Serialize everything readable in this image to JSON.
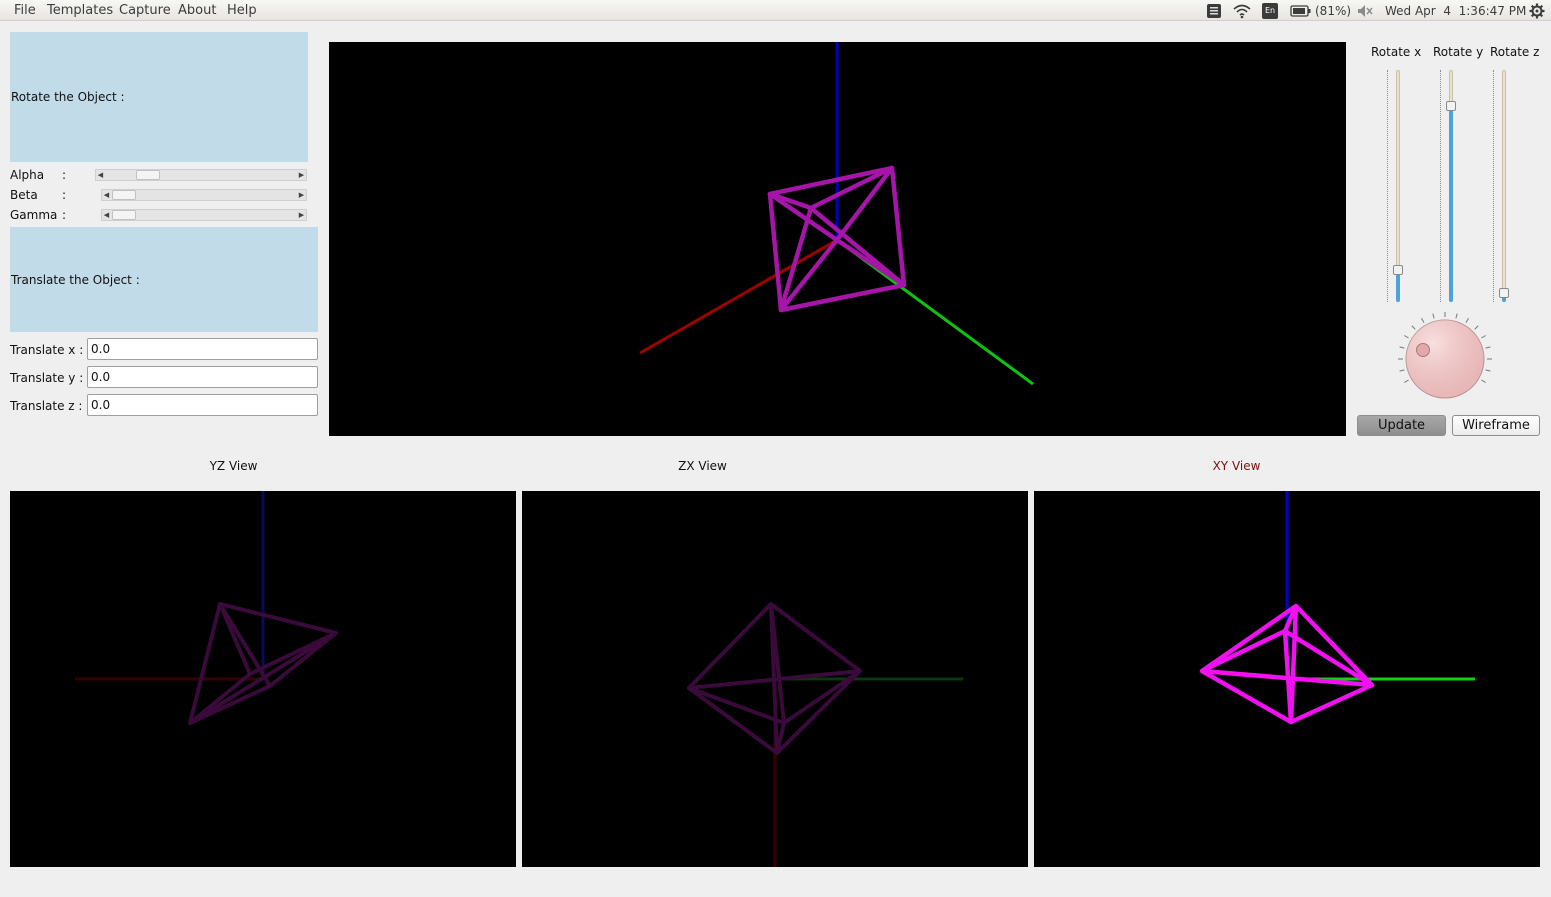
{
  "menubar": {
    "items": [
      "File",
      "Templates",
      "Capture",
      "About",
      "Help"
    ],
    "tray": {
      "keyboard_layout": "En",
      "battery": "(81%)",
      "datetime": "Wed Apr  4  1:36:47 PM"
    }
  },
  "rotate_panel": {
    "header": "Rotate the Object :",
    "params": [
      {
        "label": "Alpha",
        "colon": ":",
        "value_fraction": 0.18
      },
      {
        "label": "Beta",
        "colon": ":",
        "value_fraction": 0.0
      },
      {
        "label": "Gamma",
        "colon": ":",
        "value_fraction": 0.0
      }
    ]
  },
  "translate_panel": {
    "header": "Translate the Object :",
    "fields": [
      {
        "label": "Translate x :",
        "value": "0.0"
      },
      {
        "label": "Translate y :",
        "value": "0.0"
      },
      {
        "label": "Translate z :",
        "value": "0.0"
      }
    ]
  },
  "views": {
    "yz_title": "YZ View",
    "zx_title": "ZX View",
    "xy_title": "XY View",
    "xy_title_color": "#7a1010"
  },
  "right_panel": {
    "sliders": [
      {
        "label": "Rotate x",
        "value_fraction": 0.12
      },
      {
        "label": "Rotate y",
        "value_fraction": 0.86
      },
      {
        "label": "Rotate z",
        "value_fraction": 0.02
      }
    ],
    "dial_color": "#f4c6c6",
    "update_label": "Update",
    "wireframe_label": "Wireframe"
  },
  "colors": {
    "x_axis": "#b00000",
    "y_axis": "#12c012",
    "z_axis": "#0000c8",
    "object_main": "#b018b8",
    "object_xy": "#f010f0",
    "object_dim": "#3a0a3a",
    "panel_header_bg": "#c1dbe8"
  }
}
